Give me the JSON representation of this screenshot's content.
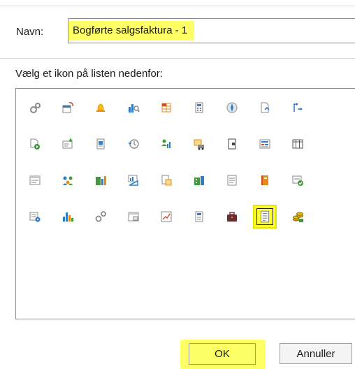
{
  "name_field": {
    "label": "Navn:",
    "value": "Bogførte salgsfaktura - 1"
  },
  "icon_list": {
    "label": "Vælg et ikon på listen nedenfor:",
    "selected_index": 34,
    "icons": [
      "gears-icon",
      "calendar-refresh-icon",
      "bell-icon",
      "chart-search-icon",
      "table-grid-icon",
      "calculator-icon",
      "globe-compass-icon",
      "document-arrow-icon",
      "flow-arrow-icon",
      "document-play-icon",
      "card-add-icon",
      "document-blue-icon",
      "clock-history-icon",
      "people-chart-icon",
      "truck-folder-icon",
      "phone-book-icon",
      "form-list-icon",
      "table-columns-icon",
      "window-list-icon",
      "people-network-icon",
      "building-charts-icon",
      "chart-ruler-icon",
      "document-box-icon",
      "building-chart-icon",
      "list-box-icon",
      "book-orange-icon",
      "document-check-icon",
      "list-settings-icon",
      "bar-chart-icon",
      "gears-small-icon",
      "window-sheet-icon",
      "line-chart-icon",
      "document-grid-icon",
      "briefcase-icon",
      "text-document-icon",
      "coins-stack-icon"
    ]
  },
  "buttons": {
    "ok": "OK",
    "cancel": "Annuller"
  },
  "colors": {
    "highlight": "#ffff66",
    "border": "#8e8e8e",
    "accent_blue": "#2f7bc6"
  }
}
